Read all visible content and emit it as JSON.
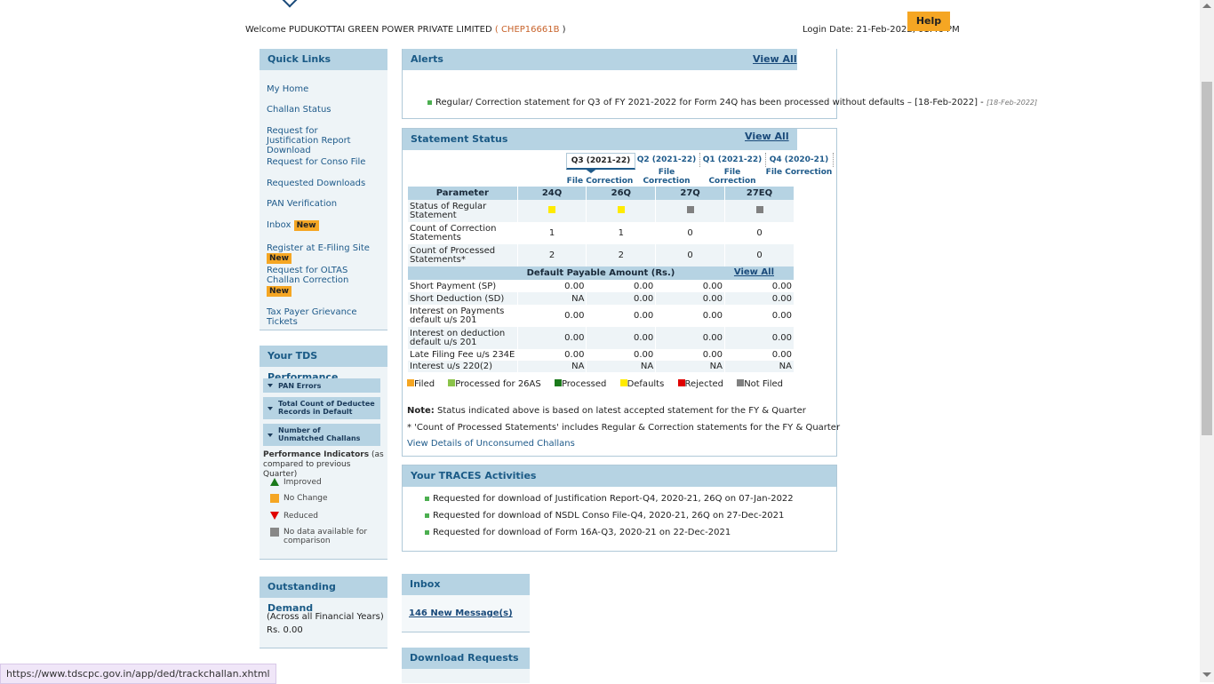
{
  "header": {
    "welcome_prefix": "Welcome PUDUKOTTAI GREEN POWER PRIVATE LIMITED",
    "open_paren": "(",
    "tan_code": "CHEP16661B",
    "close_paren": ")",
    "login_date": "Login Date: 21-Feb-2022, 01:46 PM",
    "help_label": "Help"
  },
  "quick_links": {
    "title": "Quick Links",
    "items": [
      {
        "label": "My Home"
      },
      {
        "label": "Challan Status"
      },
      {
        "label": "Request for Justification Report Download"
      },
      {
        "label": "Request for Conso File"
      },
      {
        "label": "Requested Downloads"
      },
      {
        "label": "PAN Verification"
      },
      {
        "label": "Inbox",
        "badge": "New"
      },
      {
        "label": "Register at E-Filing Site",
        "badge": "New"
      },
      {
        "label": "Request for OLTAS Challan Correction",
        "badge": "New"
      },
      {
        "label": "Tax Payer Grievance Tickets"
      }
    ]
  },
  "tds_performance": {
    "title": "Your TDS Performance",
    "bars": [
      "PAN Errors",
      "Total Count of Deductee Records in Default",
      "Number of Unmatched Challans"
    ],
    "indicators_title": "Performance Indicators",
    "indicators_note": " (as compared to previous Quarter)",
    "legend": [
      {
        "label": "Improved",
        "icon": "green-up-triangle-icon"
      },
      {
        "label": "No Change",
        "icon": "orange-square-icon"
      },
      {
        "label": "Reduced",
        "icon": "red-down-triangle-icon"
      },
      {
        "label": "No data available for comparison",
        "icon": "gray-square-icon"
      }
    ]
  },
  "outstanding_demand": {
    "title": "Outstanding Demand",
    "note": "(Across all Financial Years)",
    "amount": "Rs. 0.00"
  },
  "alerts": {
    "title": "Alerts",
    "view_all": "View All",
    "items": [
      {
        "text": "Regular/ Correction statement for Q3 of FY 2021-2022 for Form 24Q has been processed without defaults – [18-Feb-2022] -",
        "date": "[18-Feb-2022]"
      }
    ]
  },
  "statement_status": {
    "title": "Statement Status",
    "view_all": "View All",
    "tabs": [
      {
        "label": "Q3 (2021-22)",
        "sub": "File Correction",
        "active": true
      },
      {
        "label": "Q2 (2021-22)",
        "sub": "File Correction"
      },
      {
        "label": "Q1 (2021-22)",
        "sub": "File Correction"
      },
      {
        "label": "Q4 (2020-21)",
        "sub": "File Correction"
      }
    ],
    "columns": [
      "Parameter",
      "24Q",
      "26Q",
      "27Q",
      "27EQ"
    ],
    "status_row": {
      "label": "Status of Regular Statement",
      "colors": [
        "#ffeb00",
        "#ffeb00",
        "#808080",
        "#808080"
      ]
    },
    "count_rows": [
      {
        "label": "Count of Correction Statements",
        "values": [
          "1",
          "1",
          "0",
          "0"
        ]
      },
      {
        "label": "Count of Processed Statements*",
        "values": [
          "2",
          "2",
          "0",
          "0"
        ]
      }
    ],
    "default_header": "Default Payable Amount (Rs.)",
    "default_view_all": "View All",
    "default_rows": [
      {
        "label": "Short Payment (SP)",
        "values": [
          "0.00",
          "0.00",
          "0.00",
          "0.00"
        ]
      },
      {
        "label": "Short Deduction (SD)",
        "values": [
          "NA",
          "0.00",
          "0.00",
          "0.00"
        ]
      },
      {
        "label": "Interest on Payments default u/s 201",
        "values": [
          "0.00",
          "0.00",
          "0.00",
          "0.00"
        ]
      },
      {
        "label": "Interest on deduction default u/s 201",
        "values": [
          "0.00",
          "0.00",
          "0.00",
          "0.00"
        ]
      },
      {
        "label": "Late Filing Fee u/s 234E",
        "values": [
          "0.00",
          "0.00",
          "0.00",
          "0.00"
        ]
      },
      {
        "label": "Interest u/s 220(2)",
        "values": [
          "NA",
          "NA",
          "NA",
          "NA"
        ]
      }
    ],
    "legend": [
      {
        "label": "Filed",
        "color": "#f5a623"
      },
      {
        "label": "Processed for 26AS",
        "color": "#8bc34a"
      },
      {
        "label": "Processed",
        "color": "#1b7a1b"
      },
      {
        "label": "Defaults",
        "color": "#ffeb00"
      },
      {
        "label": "Rejected",
        "color": "#e00000"
      },
      {
        "label": "Not Filed",
        "color": "#808080"
      }
    ],
    "note_label": "Note:",
    "note_text": " Status indicated above is based on latest accepted statement for the FY & Quarter",
    "footnote": "* 'Count of Processed Statements' includes Regular & Correction statements for the FY & Quarter",
    "unconsumed_link": "View Details of Unconsumed Challans"
  },
  "traces": {
    "title": "Your TRACES Activities",
    "items": [
      "Requested for download of Justification Report-Q4, 2020-21, 26Q on 07-Jan-2022",
      "Requested for download of NSDL Conso File-Q4, 2020-21, 26Q on 27-Dec-2021",
      "Requested for download of Form 16A-Q3, 2020-21 on 22-Dec-2021"
    ]
  },
  "inbox": {
    "title": "Inbox",
    "link": "146 New Message(s)"
  },
  "download_requests": {
    "title": "Download Requests"
  },
  "status_bar": {
    "url": "https://www.tdscpc.gov.in/app/ded/trackchallan.xhtml"
  }
}
